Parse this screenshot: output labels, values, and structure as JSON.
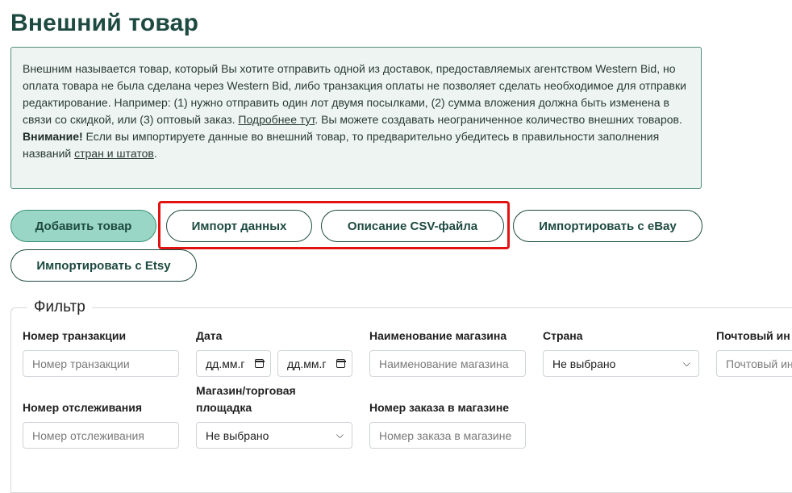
{
  "page": {
    "title": "Внешний товар"
  },
  "info": {
    "p1_text": "Внешним называется товар, который Вы хотите отправить одной из доставок, предоставляемых агентством Western Bid, но оплата товара не была сделана через Western Bid, либо транзакция оплаты не позволяет сделать необходимое для отправки редактирование. Например: (1) нужно отправить один лот двумя посылками, (2) сумма вложения должна быть изменена в связи со скидкой, или (3) оптовый заказ. ",
    "p1_link": "Подробнее тут",
    "p1_tail": ". Вы можете создавать неограниченное количество внешних товаров.",
    "warn_label": "Внимание!",
    "warn_text": " Если вы импортируете данные во внешний товар, то предварительно убедитесь в правильности заполнения названий ",
    "warn_link": "стран и штатов",
    "warn_tail": "."
  },
  "actions": {
    "add": "Добавить товар",
    "import_data": "Импорт данных",
    "csv_desc": "Описание CSV-файла",
    "import_ebay": "Импортировать с eBay",
    "import_etsy": "Импортировать с Etsy"
  },
  "filter": {
    "legend": "Фильтр",
    "transaction_label": "Номер транзакции",
    "transaction_placeholder": "Номер транзакции",
    "date_label": "Дата",
    "date_from": "дд.мм.г",
    "date_to": "дд.мм.г",
    "store_name_label": "Наименование магазина",
    "store_name_placeholder": "Наименование магазина",
    "country_label": "Страна",
    "country_value": "Не выбрано",
    "postal_label": "Почтовый ин",
    "postal_placeholder": "Почтовый ин",
    "tracking_label": "Номер отслеживания",
    "tracking_placeholder": "Номер отслеживания",
    "marketplace_label_1": "Магазин/торговая",
    "marketplace_label_2": "площадка",
    "marketplace_value": "Не выбрано",
    "order_label": "Номер заказа в магазине",
    "order_placeholder": "Номер заказа в магазине"
  },
  "colors": {
    "brand": "#1d4a40",
    "primary_button": "#9ad6c5",
    "highlight": "#e21212",
    "info_bg": "#eef4f1"
  },
  "icons": {
    "calendar": "calendar-icon",
    "dropdown": "chevron-down-icon"
  }
}
